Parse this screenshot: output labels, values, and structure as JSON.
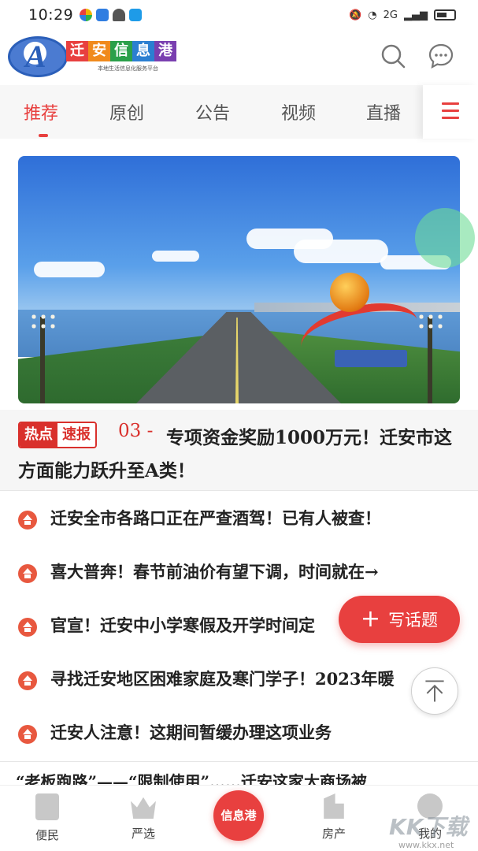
{
  "status_bar": {
    "time": "10:29",
    "network": "2G"
  },
  "header": {
    "logo_title_chars": [
      "迁",
      "安",
      "信",
      "息",
      "港"
    ],
    "logo_letter": "A",
    "logo_subtitle": "本地生活信息化服务平台",
    "icons": [
      "search-icon",
      "message-icon"
    ]
  },
  "tabs": [
    {
      "label": "推荐",
      "active": true
    },
    {
      "label": "原创",
      "active": false
    },
    {
      "label": "公告",
      "active": false
    },
    {
      "label": "视频",
      "active": false
    },
    {
      "label": "直播",
      "active": false
    }
  ],
  "headline": {
    "badge_hot": "热点",
    "badge_fast": "速报",
    "number": "03 -",
    "title": "专项资金奖励1000万元！迁安市这方面能力跃升至A类！"
  },
  "news": [
    {
      "title": "迁安全市各路口正在严查酒驾！已有人被查！"
    },
    {
      "title": "喜大普奔！春节前油价有望下调，时间就在→"
    },
    {
      "title": "官宣！迁安中小学寒假及开学时间定"
    },
    {
      "title": "寻找迁安地区困难家庭及寒门学子！2023年暖"
    },
    {
      "title": "迁安人注意！这期间暂缓办理这项业务"
    }
  ],
  "peek_text": "“老板跑路”——“限制使用”……迁安这家大商场被",
  "write_button": {
    "label": "写话题"
  },
  "bottom_nav": {
    "items": [
      {
        "label": "便民"
      },
      {
        "label": "严选"
      },
      {
        "label": "房产"
      },
      {
        "label": "我的"
      }
    ],
    "center_label": "信息港"
  },
  "watermark": {
    "text": "KK下载",
    "url": "www.kkx.net"
  },
  "colors": {
    "accent": "#e8403f",
    "logo_blue": "#2b5fb9"
  }
}
